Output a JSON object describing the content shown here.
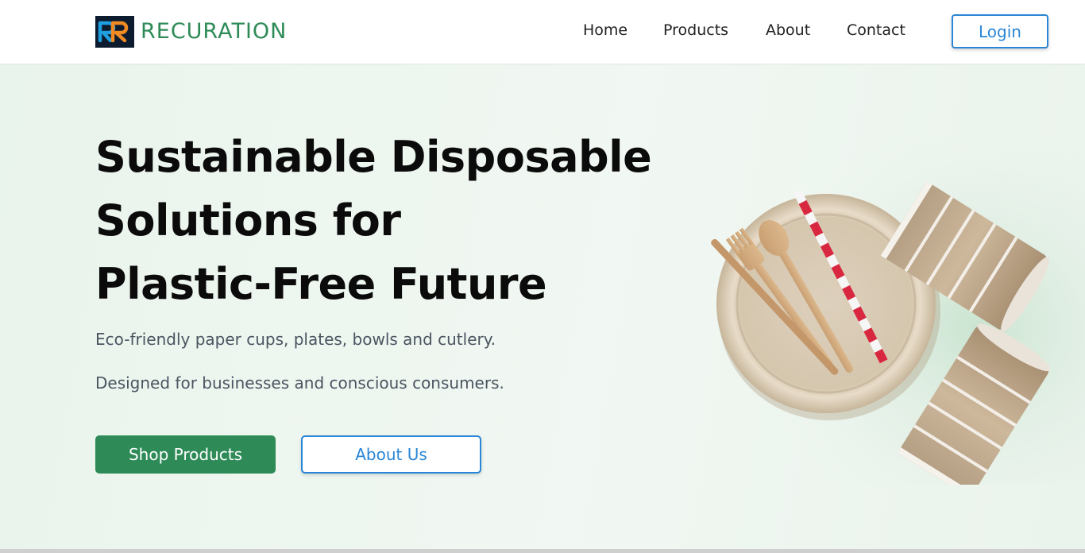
{
  "brand": {
    "name": "RECURATION",
    "logo_icon": "rr-monogram-logo",
    "color": "#2e8b57"
  },
  "nav": {
    "items": [
      {
        "label": "Home"
      },
      {
        "label": "Products"
      },
      {
        "label": "About"
      },
      {
        "label": "Contact"
      }
    ],
    "login_label": "Login"
  },
  "hero": {
    "title_lines": [
      "Sustainable Disposable",
      "Solutions for",
      "Plastic-Free Future"
    ],
    "line1": "Eco-friendly paper cups, plates, bowls and cutlery.",
    "line2": "Designed for businesses and conscious consumers.",
    "primary_cta": "Shop Products",
    "secondary_cta": "About Us",
    "image": "eco-tableware-plate-cups-cutlery-straw"
  },
  "colors": {
    "accent_green": "#2e8b57",
    "link_blue": "#2a86d6",
    "hero_bg": "#edf6ef"
  }
}
